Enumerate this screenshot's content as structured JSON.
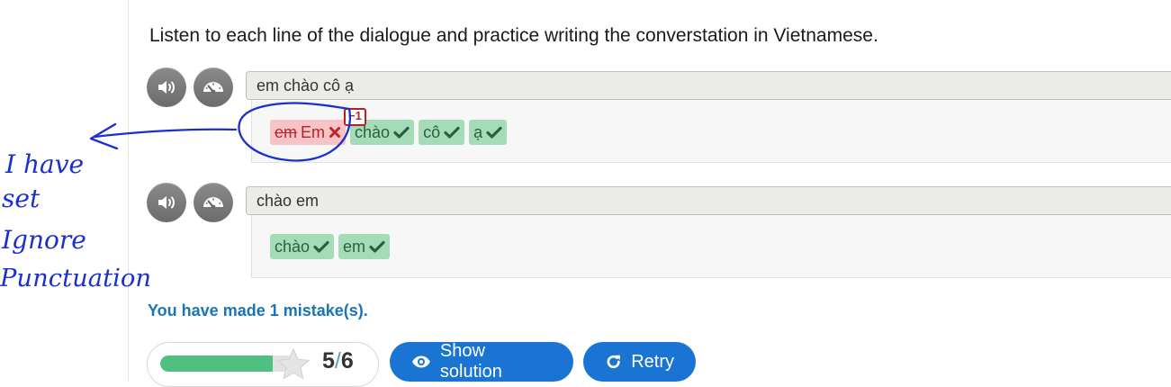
{
  "instructions": "Listen to each line of the dialogue and practice writing the converstation in Vietnamese.",
  "lines": [
    {
      "text": "em chào cô ạ",
      "tokens": [
        {
          "typed": "em",
          "correct": "Em",
          "status": "wrong"
        },
        {
          "text": "chào",
          "status": "correct"
        },
        {
          "text": "cô",
          "status": "correct"
        },
        {
          "text": "ạ",
          "status": "correct"
        }
      ],
      "penalty": "−1"
    },
    {
      "text": "chào em",
      "tokens": [
        {
          "text": "chào",
          "status": "correct"
        },
        {
          "text": "em",
          "status": "correct"
        }
      ]
    }
  ],
  "feedback": "You have made 1 mistake(s).",
  "score": {
    "current": "5",
    "max": "6",
    "separator": "/",
    "progress_fraction": 0.833
  },
  "buttons": {
    "show_solution": "Show solution",
    "retry": "Retry"
  },
  "handwritten_note": [
    "I have",
    "set",
    "Ignore",
    "Punctuation"
  ],
  "colors": {
    "accent": "#1a74d4",
    "correct_bg": "#a5dcb8",
    "wrong_bg": "#f6c4c6",
    "feedback": "#1a74b8",
    "progress": "#4fc080",
    "annotation_ink": "#1b2fcc"
  },
  "icons": {
    "audio": "speaker-icon",
    "slow": "speedometer-icon",
    "correct": "check-icon",
    "wrong": "x-icon",
    "star": "star-icon",
    "solution": "eye-icon",
    "retry": "redo-icon"
  }
}
